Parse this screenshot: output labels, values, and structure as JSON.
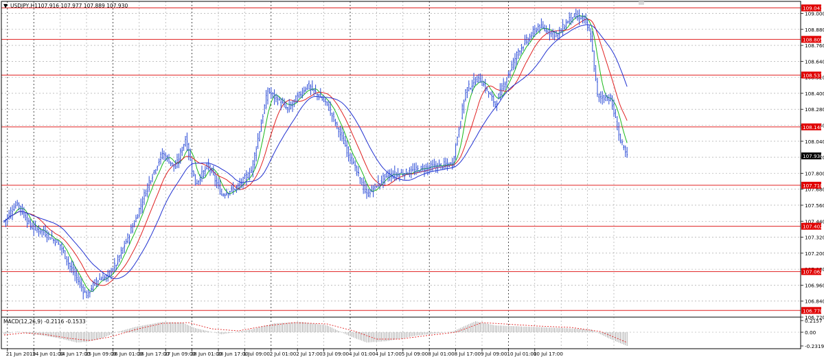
{
  "window": {
    "menu_glyph": "▼",
    "symbol_label": "USDJPY,H1",
    "ohlc": "107.916 107.977 107.889 107.930"
  },
  "colors": {
    "price": "#2748d6",
    "ma_fast": "#18b818",
    "ma_mid": "#e02020",
    "ma_slow": "#2030d0",
    "level_line": "#e02020",
    "level_label_bg": "#e00000",
    "current_label_bg": "#000000",
    "grid": "#9a9a9a",
    "vgrid_major": "#000000",
    "macd_hist": "#9a9a9a",
    "macd_signal": "#e02020"
  },
  "chart_data": [
    {
      "type": "line",
      "title": "USDJPY,H1",
      "price_axis": {
        "ylim": [
          106.72,
          109.09
        ],
        "tick_labels": [
          "109.000",
          "108.880",
          "108.760",
          "108.640",
          "108.520",
          "108.400",
          "108.280",
          "108.160",
          "108.040",
          "107.920",
          "107.800",
          "107.680",
          "107.560",
          "107.440",
          "107.320",
          "107.200",
          "107.080",
          "106.960",
          "106.840",
          "106.720"
        ],
        "current_price": "107.930"
      },
      "time_axis": {
        "tick_labels": [
          "21 Jun 2019",
          "24 Jun 01:00",
          "24 Jun 17:00",
          "25 Jun 09:00",
          "26 Jun 01:00",
          "26 Jun 17:00",
          "27 Jun 09:00",
          "28 Jun 01:00",
          "28 Jun 17:00",
          "1 Jul 09:00",
          "2 Jul 01:00",
          "2 Jul 17:00",
          "3 Jul 09:00",
          "4 Jul 01:00",
          "4 Jul 17:00",
          "5 Jul 09:00",
          "8 Jul 01:00",
          "8 Jul 17:00",
          "9 Jul 09:00",
          "10 Jul 01:00",
          "10 Jul 17:00"
        ],
        "bars_per_tick": 16
      },
      "horizontal_levels": [
        "109.041",
        "108.805",
        "108.537",
        "108.148",
        "107.710",
        "107.402",
        "107.062",
        "106.770"
      ],
      "price_key_points": [
        [
          0,
          107.44
        ],
        [
          8,
          107.58
        ],
        [
          16,
          107.4
        ],
        [
          24,
          107.36
        ],
        [
          34,
          107.26
        ],
        [
          40,
          107.1
        ],
        [
          46,
          106.97
        ],
        [
          50,
          106.88
        ],
        [
          56,
          107.0
        ],
        [
          62,
          107.02
        ],
        [
          68,
          107.12
        ],
        [
          80,
          107.46
        ],
        [
          88,
          107.74
        ],
        [
          96,
          107.95
        ],
        [
          104,
          107.84
        ],
        [
          110,
          108.06
        ],
        [
          116,
          107.72
        ],
        [
          124,
          107.86
        ],
        [
          132,
          107.64
        ],
        [
          142,
          107.7
        ],
        [
          150,
          107.82
        ],
        [
          160,
          108.42
        ],
        [
          172,
          108.28
        ],
        [
          184,
          108.46
        ],
        [
          196,
          108.32
        ],
        [
          210,
          107.92
        ],
        [
          220,
          107.64
        ],
        [
          232,
          107.78
        ],
        [
          242,
          107.8
        ],
        [
          256,
          107.84
        ],
        [
          272,
          107.87
        ],
        [
          280,
          108.42
        ],
        [
          288,
          108.52
        ],
        [
          298,
          108.32
        ],
        [
          312,
          108.72
        ],
        [
          324,
          108.9
        ],
        [
          336,
          108.84
        ],
        [
          344,
          108.98
        ],
        [
          352,
          108.96
        ],
        [
          356,
          108.82
        ],
        [
          360,
          108.38
        ],
        [
          368,
          108.36
        ],
        [
          374,
          108.04
        ],
        [
          378,
          107.92
        ]
      ],
      "series": [
        {
          "kind": "bars",
          "values_ref": "price_key_points",
          "color": "price"
        },
        {
          "kind": "ma",
          "period": 7,
          "color": "ma_fast"
        },
        {
          "kind": "ma",
          "period": 16,
          "color": "ma_mid"
        },
        {
          "kind": "ma",
          "period": 30,
          "color": "ma_slow"
        }
      ],
      "grid": true
    },
    {
      "type": "bar",
      "title": "MACD(12,26,9)",
      "readout": "MACD(12,26,9) -0.2116 -0.1533",
      "ylim": [
        -0.2319,
        0.2157
      ],
      "tick_labels": [
        "0.2157",
        "0.00",
        "-0.2319"
      ],
      "histogram_key_points": [
        [
          0,
          -0.03
        ],
        [
          8,
          0.01
        ],
        [
          16,
          -0.02
        ],
        [
          24,
          -0.05
        ],
        [
          34,
          -0.09
        ],
        [
          44,
          -0.15
        ],
        [
          50,
          -0.14
        ],
        [
          58,
          -0.1
        ],
        [
          68,
          0.0
        ],
        [
          80,
          0.08
        ],
        [
          96,
          0.15
        ],
        [
          108,
          0.14
        ],
        [
          116,
          0.06
        ],
        [
          132,
          -0.03
        ],
        [
          150,
          0.04
        ],
        [
          164,
          0.13
        ],
        [
          180,
          0.15
        ],
        [
          196,
          0.1
        ],
        [
          210,
          -0.06
        ],
        [
          220,
          -0.15
        ],
        [
          232,
          -0.13
        ],
        [
          250,
          -0.05
        ],
        [
          272,
          0.01
        ],
        [
          286,
          0.16
        ],
        [
          298,
          0.1
        ],
        [
          318,
          0.08
        ],
        [
          340,
          0.06
        ],
        [
          356,
          0.04
        ],
        [
          368,
          -0.1
        ],
        [
          378,
          -0.2
        ]
      ],
      "signal_key_points": [
        [
          0,
          -0.04
        ],
        [
          12,
          -0.01
        ],
        [
          24,
          -0.03
        ],
        [
          40,
          -0.09
        ],
        [
          52,
          -0.12
        ],
        [
          64,
          -0.07
        ],
        [
          80,
          0.04
        ],
        [
          96,
          0.13
        ],
        [
          112,
          0.14
        ],
        [
          126,
          0.05
        ],
        [
          142,
          0.02
        ],
        [
          158,
          0.09
        ],
        [
          176,
          0.14
        ],
        [
          196,
          0.12
        ],
        [
          212,
          0.02
        ],
        [
          226,
          -0.1
        ],
        [
          240,
          -0.1
        ],
        [
          256,
          -0.05
        ],
        [
          274,
          0.0
        ],
        [
          290,
          0.14
        ],
        [
          304,
          0.12
        ],
        [
          324,
          0.09
        ],
        [
          344,
          0.07
        ],
        [
          362,
          0.01
        ],
        [
          378,
          -0.15
        ]
      ]
    }
  ]
}
